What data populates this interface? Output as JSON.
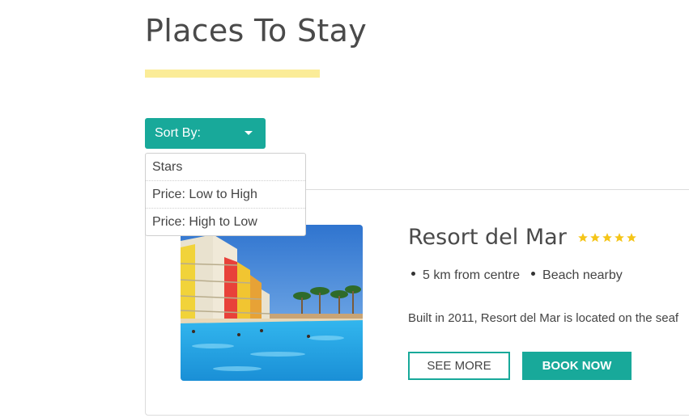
{
  "page": {
    "title": "Places To Stay"
  },
  "sort": {
    "label": "Sort By:",
    "options": [
      "Stars",
      "Price: Low to High",
      "Price: High to Low"
    ]
  },
  "hotel": {
    "name": "Resort del Mar",
    "rating": 5,
    "features": [
      "5 km from centre",
      "Beach nearby"
    ],
    "description": "Built in 2011, Resort del Mar is located on the seaf",
    "see_more_label": "SEE MORE",
    "book_now_label": "BOOK NOW"
  },
  "colors": {
    "accent": "#18a99a",
    "underline": "#fbec98",
    "star": "#f5c518"
  },
  "icons": {
    "sort_caret": "caret-down-icon",
    "star": "star-icon"
  }
}
